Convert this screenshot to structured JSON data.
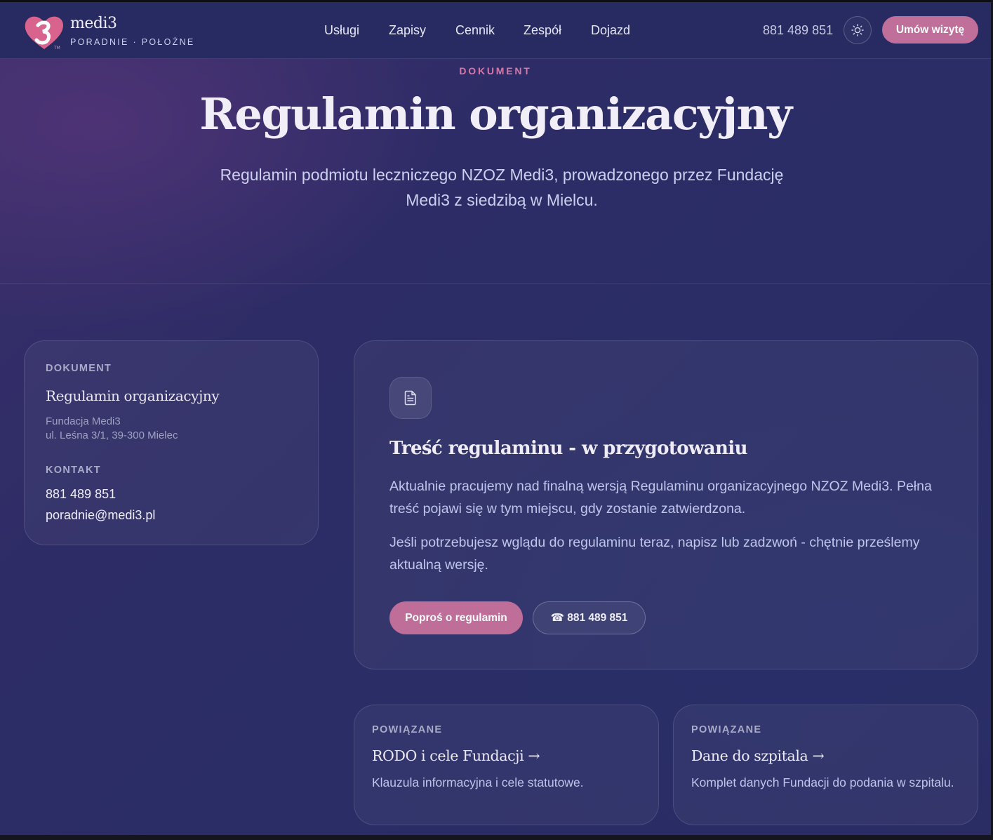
{
  "header": {
    "brand_name": "medi3",
    "brand_sub": "PORADNIE · POŁOŻNE",
    "nav": [
      {
        "label": "Usługi"
      },
      {
        "label": "Zapisy"
      },
      {
        "label": "Cennik"
      },
      {
        "label": "Zespół"
      },
      {
        "label": "Dojazd"
      }
    ],
    "phone": "881 489 851",
    "cta": "Umów wizytę"
  },
  "hero": {
    "eyebrow": "DOKUMENT",
    "title": "Regulamin organizacyjny",
    "subtitle": "Regulamin podmiotu leczniczego NZOZ Medi3, prowadzonego przez Fundację Medi3 z siedzibą w Mielcu."
  },
  "sidebar": {
    "doc_label": "DOKUMENT",
    "doc_title": "Regulamin organizacyjny",
    "address_line1": "Fundacja Medi3",
    "address_line2": "ul. Leśna 3/1, 39-300 Mielec",
    "contact_label": "KONTAKT",
    "phone": "881 489 851",
    "email": "poradnie@medi3.pl"
  },
  "main": {
    "icon": "document-icon",
    "title": "Treść regulaminu - w przygotowaniu",
    "paragraph1": "Aktualnie pracujemy nad finalną wersją Regulaminu organizacyjnego NZOZ Medi3. Pełna treść pojawi się w tym miejscu, gdy zostanie zatwierdzona.",
    "paragraph2": "Jeśli potrzebujesz wglądu do regulaminu teraz, napisz lub zadzwoń - chętnie prześlemy aktualną wersję.",
    "primary_button": "Poproś o regulamin",
    "phone_button": "☎ 881 489 851"
  },
  "related": [
    {
      "label": "POWIĄZANE",
      "title": "RODO i cele Fundacji →",
      "desc": "Klauzula informacyjna i cele statutowe."
    },
    {
      "label": "POWIĄZANE",
      "title": "Dane do szpitala →",
      "desc": "Komplet danych Fundacji do podania w szpitalu."
    }
  ],
  "colors": {
    "accent": "#c06e9a",
    "eyebrow": "#d678a8",
    "background": "#2b2c64",
    "header": "#272b62"
  }
}
